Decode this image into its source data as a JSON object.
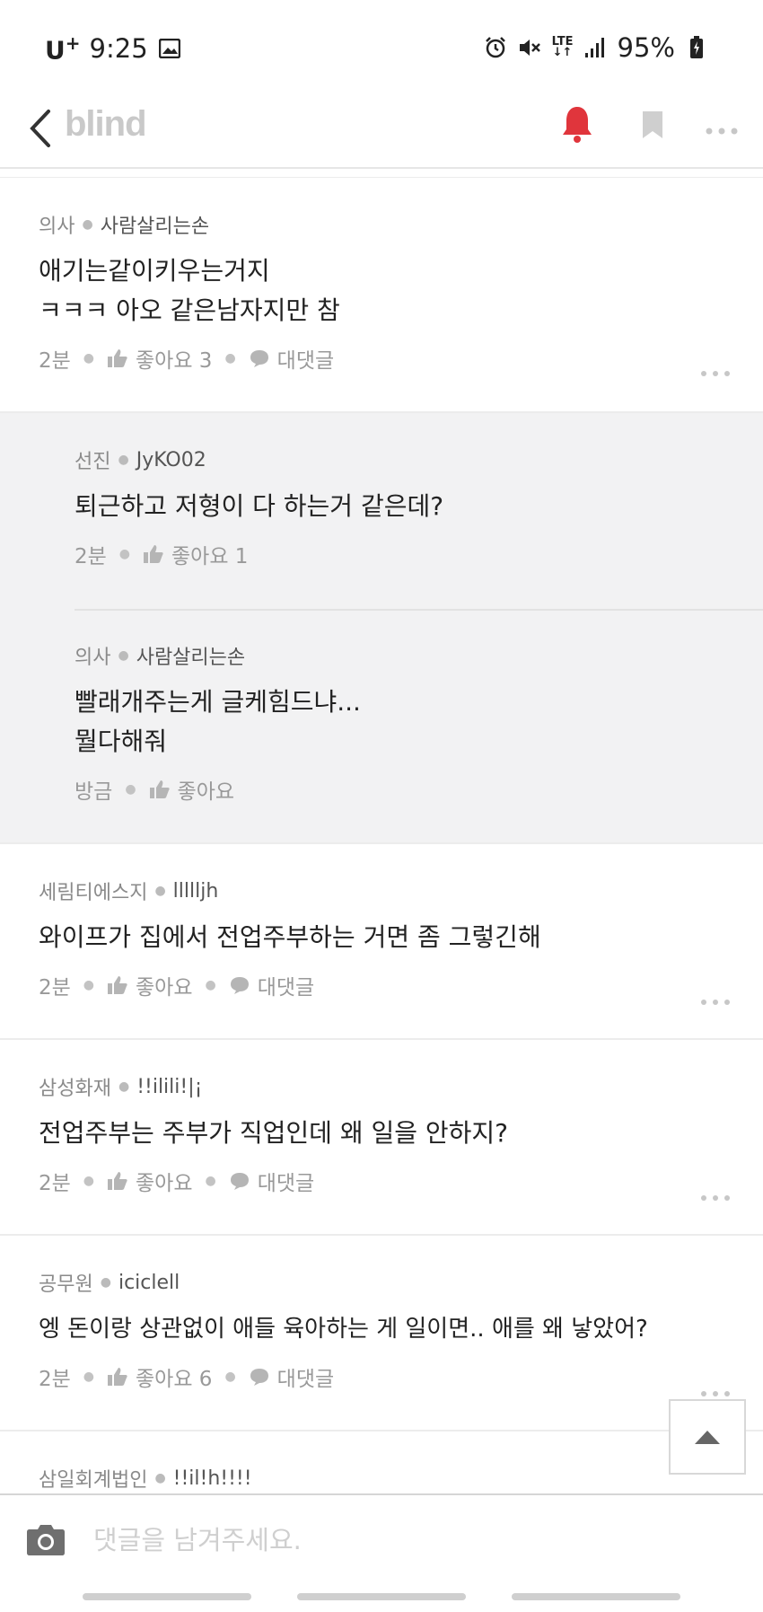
{
  "status_bar": {
    "carrier": "U",
    "carrier_sup": "+",
    "time": "9:25",
    "battery": "95%"
  },
  "app_bar": {
    "logo": "blind"
  },
  "comments": [
    {
      "company": "의사",
      "nickname": "사람살리는손",
      "lines": [
        "애기는같이키우는거지",
        "ㅋㅋㅋ 아오 같은남자지만 참"
      ],
      "time": "2분",
      "like_label": "좋아요 3",
      "reply_label": "대댓글"
    },
    {
      "company": "세림티에스지",
      "nickname": "llllljh",
      "lines": [
        "와이프가 집에서 전업주부하는 거면 좀 그렇긴해"
      ],
      "time": "2분",
      "like_label": "좋아요",
      "reply_label": "대댓글"
    },
    {
      "company": "삼성화재",
      "nickname": "!!ilili!|¡",
      "lines": [
        "전업주부는 주부가 직업인데 왜 일을 안하지?"
      ],
      "time": "2분",
      "like_label": "좋아요",
      "reply_label": "대댓글"
    },
    {
      "company": "공무원",
      "nickname": "iciclell",
      "lines": [
        "엥 돈이랑 상관없이 애들 육아하는 게 일이면.. 애를 왜 낳았어?"
      ],
      "time": "2분",
      "like_label": "좋아요 6",
      "reply_label": "대댓글"
    },
    {
      "company": "삼일회계법인",
      "nickname": "!!il!h!!!!"
    }
  ],
  "replies": [
    {
      "company": "선진",
      "nickname": "JyKO02",
      "lines": [
        "퇴근하고 저형이 다 하는거 같은데?"
      ],
      "time": "2분",
      "like_label": "좋아요 1"
    },
    {
      "company": "의사",
      "nickname": "사람살리는손",
      "lines": [
        "빨래개주는게 글케힘드냐...",
        "뭘다해줘"
      ],
      "time": "방금",
      "like_label": "좋아요"
    }
  ],
  "input": {
    "placeholder": "댓글을 남겨주세요."
  },
  "colors": {
    "bell": "#e0353c",
    "logo": "#c9c9c9",
    "reply_bg": "#f2f2f3"
  }
}
